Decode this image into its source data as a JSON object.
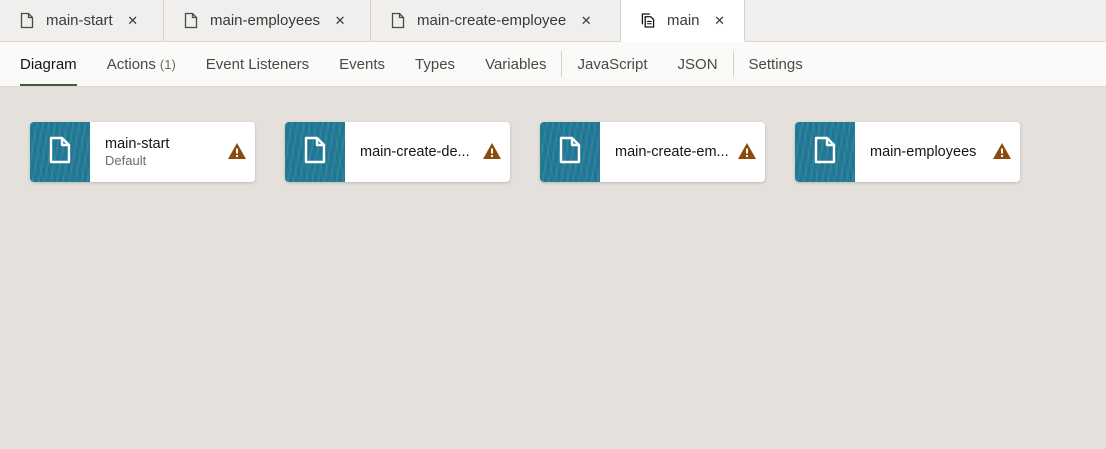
{
  "tabs": [
    {
      "label": "main-start",
      "icon": "page-icon"
    },
    {
      "label": "main-employees",
      "icon": "page-icon"
    },
    {
      "label": "main-create-employee",
      "icon": "page-icon"
    },
    {
      "label": "main",
      "icon": "flow-icon",
      "active": true
    }
  ],
  "subnav": {
    "diagram": "Diagram",
    "actions": "Actions",
    "actions_count": "(1)",
    "event_listeners": "Event Listeners",
    "events": "Events",
    "types": "Types",
    "variables": "Variables",
    "javascript": "JavaScript",
    "json": "JSON",
    "settings": "Settings"
  },
  "cards": [
    {
      "title": "main-start",
      "subtitle": "Default",
      "warning": true
    },
    {
      "title": "main-create-de...",
      "subtitle": "",
      "warning": true
    },
    {
      "title": "main-create-em...",
      "subtitle": "",
      "warning": true
    },
    {
      "title": "main-employees",
      "subtitle": "",
      "warning": true
    }
  ],
  "colors": {
    "thumb": "#227a96",
    "warning": "#8a4b0f",
    "active_underline": "#415d3e",
    "canvas": "#e4e1dc"
  }
}
